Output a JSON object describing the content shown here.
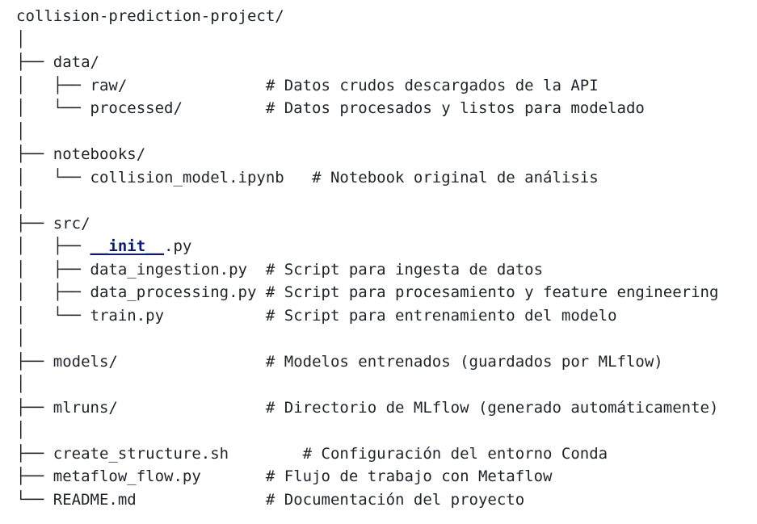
{
  "tree": {
    "rows": [
      {
        "prefix": "",
        "name": "collision-prediction-project/",
        "pad": "",
        "comment": ""
      },
      {
        "prefix": "│",
        "name": "",
        "pad": "",
        "comment": ""
      },
      {
        "prefix": "├── ",
        "name": "data/",
        "pad": "",
        "comment": ""
      },
      {
        "prefix": "│   ├── ",
        "name": "raw/",
        "pad": "               ",
        "comment": "# Datos crudos descargados de la API"
      },
      {
        "prefix": "│   └── ",
        "name": "processed/",
        "pad": "         ",
        "comment": "# Datos procesados y listos para modelado"
      },
      {
        "prefix": "│",
        "name": "",
        "pad": "",
        "comment": ""
      },
      {
        "prefix": "├── ",
        "name": "notebooks/",
        "pad": "",
        "comment": ""
      },
      {
        "prefix": "│   └── ",
        "name": "collision_model.ipynb",
        "pad": "   ",
        "comment": "# Notebook original de análisis"
      },
      {
        "prefix": "│",
        "name": "",
        "pad": "",
        "comment": ""
      },
      {
        "prefix": "├── ",
        "name": "src/",
        "pad": "",
        "comment": ""
      },
      {
        "prefix": "│   ├── ",
        "name": "",
        "dunder": "__init__",
        "suffix": ".py",
        "pad": "",
        "comment": ""
      },
      {
        "prefix": "│   ├── ",
        "name": "data_ingestion.py",
        "pad": "  ",
        "comment": "# Script para ingesta de datos"
      },
      {
        "prefix": "│   ├── ",
        "name": "data_processing.py",
        "pad": " ",
        "comment": "# Script para procesamiento y feature engineering"
      },
      {
        "prefix": "│   └── ",
        "name": "train.py",
        "pad": "           ",
        "comment": "# Script para entrenamiento del modelo"
      },
      {
        "prefix": "│",
        "name": "",
        "pad": "",
        "comment": ""
      },
      {
        "prefix": "├── ",
        "name": "models/",
        "pad": "                ",
        "comment": "# Modelos entrenados (guardados por MLflow)"
      },
      {
        "prefix": "│",
        "name": "",
        "pad": "",
        "comment": ""
      },
      {
        "prefix": "├── ",
        "name": "mlruns/",
        "pad": "                ",
        "comment": "# Directorio de MLflow (generado automáticamente)"
      },
      {
        "prefix": "│",
        "name": "",
        "pad": "",
        "comment": ""
      },
      {
        "prefix": "├── ",
        "name": "create_structure.sh",
        "pad": "        ",
        "comment": "# Configuración del entorno Conda"
      },
      {
        "prefix": "├── ",
        "name": "metaflow_flow.py",
        "pad": "       ",
        "comment": "# Flujo de trabajo con Metaflow"
      },
      {
        "prefix": "└── ",
        "name": "README.md",
        "pad": "              ",
        "comment": "# Documentación del proyecto"
      }
    ]
  }
}
